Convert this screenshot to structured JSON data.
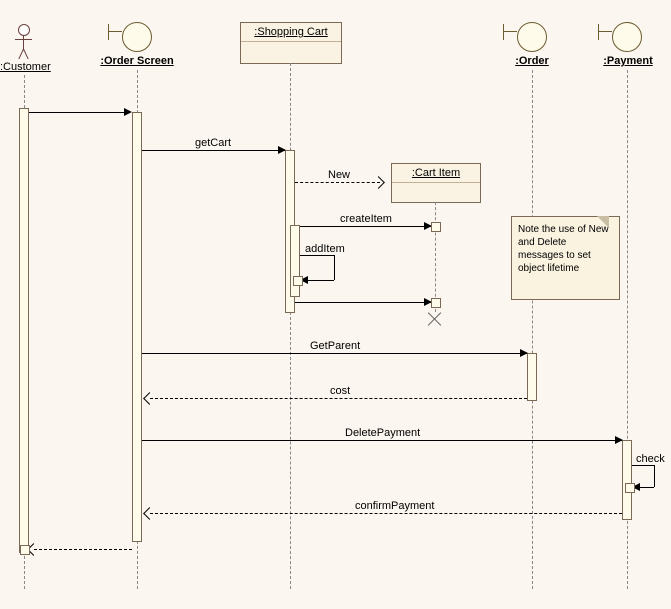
{
  "lifelines": {
    "customer": ":Customer",
    "order_screen": ":Order Screen",
    "shopping_cart": ":Shopping Cart",
    "cart_item": ":Cart Item",
    "order": ":Order",
    "payment": ":Payment"
  },
  "messages": {
    "get_cart": "getCart",
    "new": "New",
    "create_item": "createItem",
    "add_item": "addItem",
    "get_parent": "GetParent",
    "cost": "cost",
    "delete_payment": "DeletePayment",
    "check": "check",
    "confirm_payment": "confirmPayment"
  },
  "note": {
    "text": "Note the use of New and Delete messages to set object lifetime"
  },
  "chart_data": {
    "type": "sequence-diagram",
    "lifelines": [
      {
        "id": "customer",
        "label": ":Customer",
        "kind": "actor"
      },
      {
        "id": "order_screen",
        "label": ":Order Screen",
        "kind": "boundary"
      },
      {
        "id": "shopping_cart",
        "label": ":Shopping Cart",
        "kind": "object"
      },
      {
        "id": "cart_item",
        "label": ":Cart Item",
        "kind": "object",
        "created_by": "new",
        "destroyed": true
      },
      {
        "id": "order",
        "label": ":Order",
        "kind": "boundary"
      },
      {
        "id": "payment",
        "label": ":Payment",
        "kind": "boundary"
      }
    ],
    "messages": [
      {
        "from": "customer",
        "to": "order_screen",
        "label": "",
        "type": "sync"
      },
      {
        "from": "order_screen",
        "to": "shopping_cart",
        "label": "getCart",
        "type": "sync"
      },
      {
        "from": "shopping_cart",
        "to": "cart_item",
        "label": "New",
        "type": "create"
      },
      {
        "from": "shopping_cart",
        "to": "cart_item",
        "label": "createItem",
        "type": "sync"
      },
      {
        "from": "shopping_cart",
        "to": "shopping_cart",
        "label": "addItem",
        "type": "self"
      },
      {
        "from": "shopping_cart",
        "to": "cart_item",
        "label": "",
        "type": "delete"
      },
      {
        "from": "order_screen",
        "to": "order",
        "label": "GetParent",
        "type": "sync"
      },
      {
        "from": "order",
        "to": "order_screen",
        "label": "cost",
        "type": "return"
      },
      {
        "from": "order_screen",
        "to": "payment",
        "label": "DeletePayment",
        "type": "sync"
      },
      {
        "from": "payment",
        "to": "payment",
        "label": "check",
        "type": "self"
      },
      {
        "from": "payment",
        "to": "order_screen",
        "label": "confirmPayment",
        "type": "return"
      },
      {
        "from": "order_screen",
        "to": "customer",
        "label": "",
        "type": "return"
      }
    ],
    "notes": [
      {
        "text": "Note the use of New and Delete messages to set object lifetime",
        "attached_to": "order"
      }
    ]
  }
}
